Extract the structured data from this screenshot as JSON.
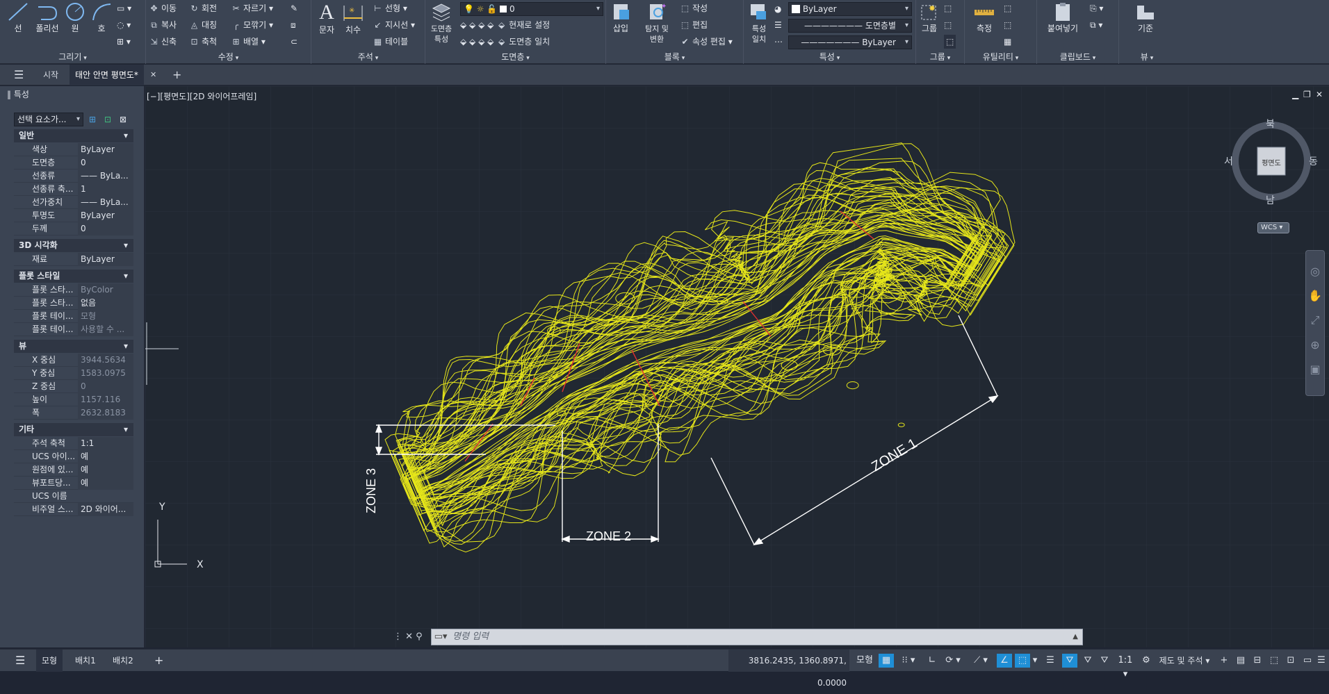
{
  "ribbon": {
    "draw": {
      "title": "그리기",
      "line": "선",
      "polyline": "폴리선",
      "circle": "원",
      "arc": "호"
    },
    "modify": {
      "title": "수정",
      "move": "이동",
      "rotate": "회전",
      "trim": "자르기",
      "copy": "복사",
      "mirror": "대칭",
      "fillet": "모깎기",
      "stretch": "신축",
      "scale": "축척",
      "array": "배열"
    },
    "annotation": {
      "title": "주석",
      "text": "문자",
      "dimension": "치수",
      "linear": "선형",
      "leader": "지시선",
      "table": "테이블"
    },
    "layers": {
      "title": "도면층",
      "layer_props": "도면층\n특성",
      "current_layer": "0",
      "make_current": "현재로 설정",
      "match_layer": "도면층 일치"
    },
    "block": {
      "title": "블록",
      "insert": "삽입",
      "explore": "탐지 및\n변환",
      "create": "작성",
      "edit": "편집",
      "edit_attr": "속성 편집"
    },
    "properties": {
      "title": "특성",
      "match_props": "특성\n일치",
      "color": "ByLayer",
      "linetype": "도면층별",
      "lineweight": "ByLayer"
    },
    "groups": {
      "title": "그룹",
      "group": "그룹"
    },
    "utilities": {
      "title": "유틸리티",
      "measure": "측정"
    },
    "clipboard": {
      "title": "클립보드",
      "paste": "붙여넣기"
    },
    "view": {
      "title": "뷰",
      "base": "기준"
    }
  },
  "tabs": {
    "start": "시작",
    "active": "태안 안면 평면도*"
  },
  "props": {
    "title": "특성",
    "selector": "선택 요소가...",
    "sections": [
      {
        "name": "일반",
        "rows": [
          [
            "색상",
            "ByLayer"
          ],
          [
            "도면층",
            "0"
          ],
          [
            "선종류",
            "—— ByLa..."
          ],
          [
            "선종류 축...",
            "1"
          ],
          [
            "선가중치",
            "—— ByLa..."
          ],
          [
            "투명도",
            "ByLayer"
          ],
          [
            "두께",
            "0"
          ]
        ]
      },
      {
        "name": "3D 시각화",
        "rows": [
          [
            "재료",
            "ByLayer"
          ]
        ]
      },
      {
        "name": "플롯 스타일",
        "rows": [
          [
            "플롯 스타...",
            "ByColor"
          ],
          [
            "플롯 스타...",
            "없음"
          ],
          [
            "플롯 테이...",
            "모형"
          ],
          [
            "플롯 테이...",
            "사용할 수 ..."
          ]
        ]
      },
      {
        "name": "뷰",
        "rows": [
          [
            "X 중심",
            "3944.5634"
          ],
          [
            "Y 중심",
            "1583.0975"
          ],
          [
            "Z 중심",
            "0"
          ],
          [
            "높이",
            "1157.116"
          ],
          [
            "폭",
            "2632.8183"
          ]
        ]
      },
      {
        "name": "기타",
        "rows": [
          [
            "주석 축척",
            "1:1"
          ],
          [
            "UCS 아이...",
            "예"
          ],
          [
            "원점에 있...",
            "예"
          ],
          [
            "뷰포트당...",
            "예"
          ],
          [
            "UCS 이름",
            ""
          ],
          [
            "비주얼 스...",
            "2D 와이어..."
          ]
        ]
      }
    ]
  },
  "viewport": {
    "label": "[−][평면도][2D 와이어프레임]",
    "zone1": "ZONE 1",
    "zone2": "ZONE 2",
    "zone3": "ZONE 3"
  },
  "viewcube": {
    "north": "북",
    "south": "남",
    "east": "동",
    "west": "서",
    "face": "평면도",
    "wcs": "WCS"
  },
  "ucs": {
    "x": "X",
    "y": "Y"
  },
  "command": {
    "placeholder": "명령 입력"
  },
  "status": {
    "model": "모형",
    "layout1": "배치1",
    "layout2": "배치2",
    "coords": "3816.2435, 1360.8971, 0.0000",
    "model_btn": "모형",
    "scale": "1:1",
    "workspace": "제도 및 주석"
  },
  "colors": {
    "accent": "#1f8fd6",
    "contour": "#e6e61a",
    "section_line": "#e03030"
  }
}
